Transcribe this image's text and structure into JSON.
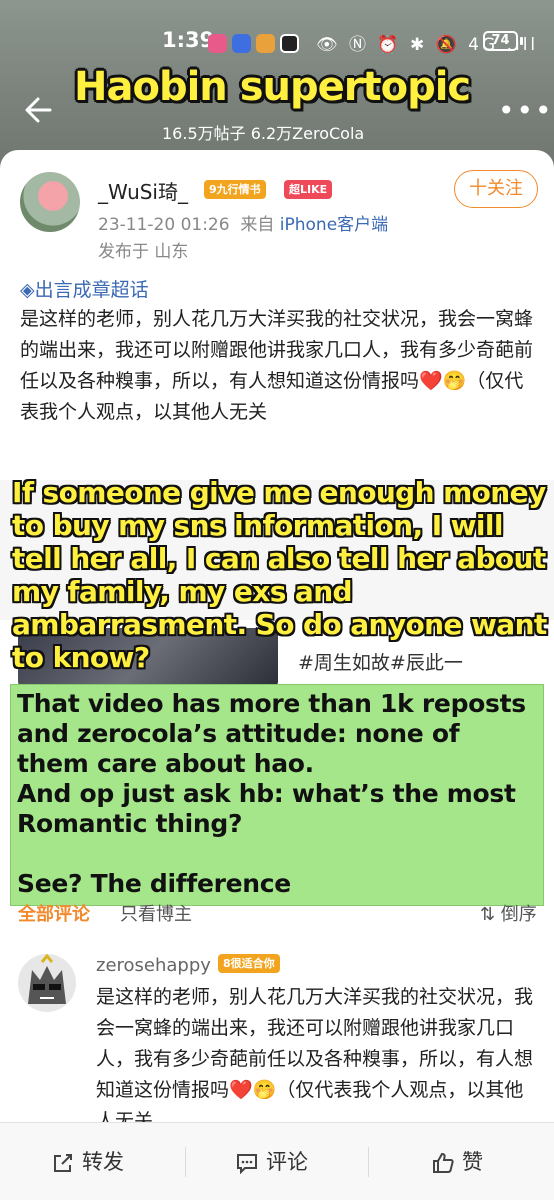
{
  "status_bar": {
    "time": "1:39",
    "icons": "👁 Ⓝ ⏰ ✱ 🔕 4G .ıll",
    "battery": "74"
  },
  "header": {
    "overlay_title": "Haobin supertopic",
    "stats": "16.5万帖子 6.2万ZeroCola"
  },
  "post": {
    "username": "_WuSi琦_",
    "badge_level": "9九行情书",
    "badge_like": "超LIKE",
    "follow_label": "十关注",
    "meta_time": "23-11-20 01:26",
    "meta_from": "来自",
    "meta_device": "iPhone客户端",
    "location": "发布于 山东",
    "topic": "◈出言成章超话",
    "text": "是这样的老师，别人花几万大洋买我的社交状况，我会一窝蜂的端出来，我还可以附赠跟他讲我家几口人，我有多少奇葩前任以及各种糗事，所以，有人想知道这份情报吗❤️🤭（仅代表我个人观点，以其他人无关"
  },
  "overlay_english": "If someone give me enough money to buy my sns information, I will tell her all, I can also tell her about my family, my exs and ambarrasment. So do anyone want to know?",
  "video": {
    "hashtag": "#周生如故#辰此一",
    "close": "✕"
  },
  "green_note": {
    "line1": "That video has more than 1k reposts and zerocola’s attitude: none of them care about hao.",
    "line2": "And op just ask hb: what’s the most Romantic thing?",
    "line3": "See? The difference"
  },
  "comments": {
    "tab_all": "全部评论",
    "tab_op": "只看博主",
    "tab_sort": "⇅ 倒序",
    "items": [
      {
        "name": "zerosehappy",
        "badge": "8很适合你",
        "text": "是这样的老师，别人花几万大洋买我的社交状况，我会一窝蜂的端出来，我还可以附赠跟他讲我家几口人，我有多少奇葩前任以及各种糗事，所以，有人想知道这份情报吗❤️🤭（仅代表我个人观点，以其他人无关"
      }
    ]
  },
  "bottom_bar": {
    "repost": "转发",
    "comment": "评论",
    "like": "赞"
  },
  "colors": {
    "accent": "#f28a2d",
    "link": "#3b69b4",
    "overlay_yellow": "#fff040",
    "note_green": "#a5e68a"
  }
}
